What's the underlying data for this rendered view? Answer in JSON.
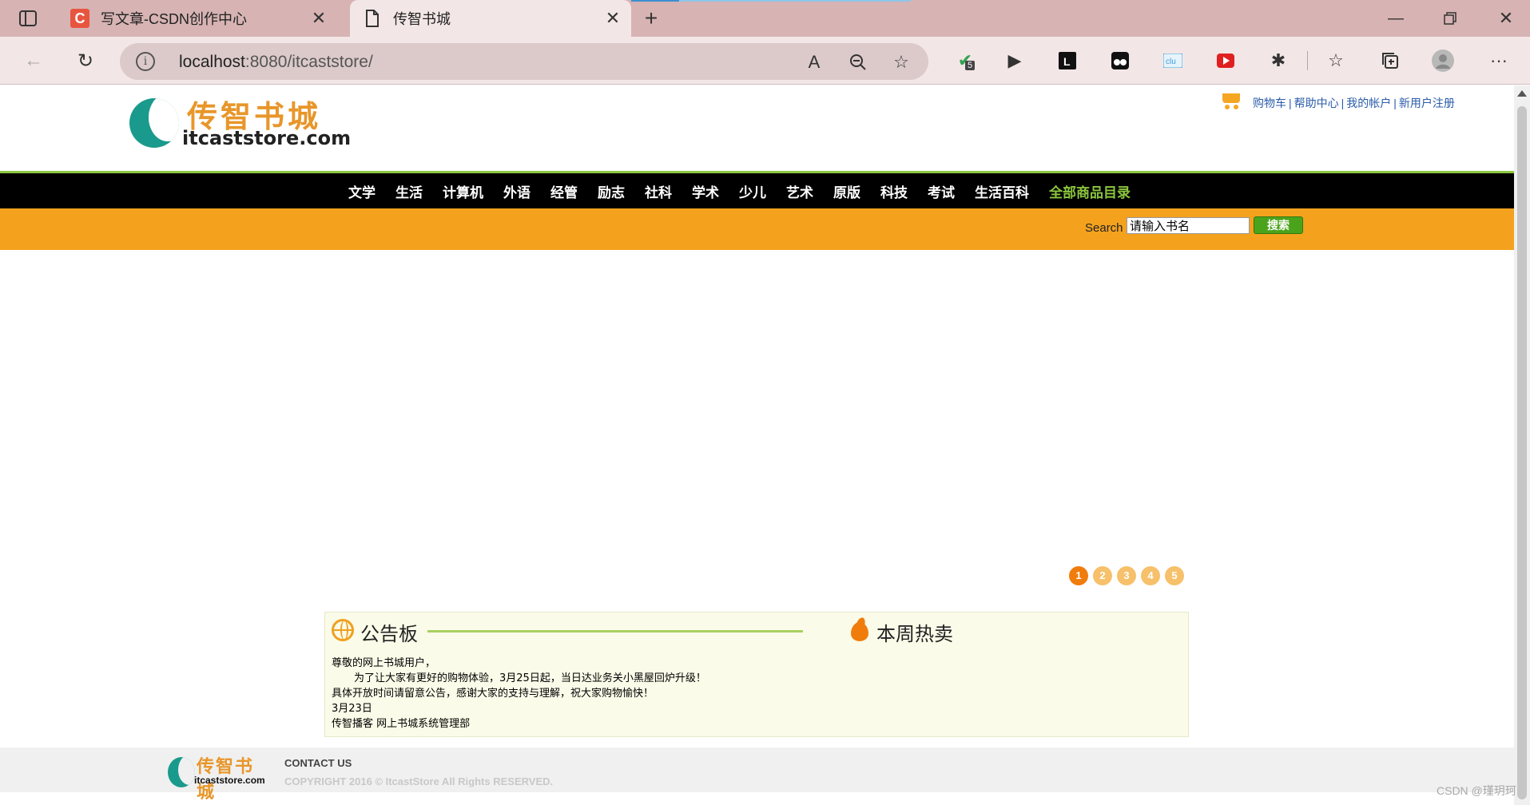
{
  "browser": {
    "tabs": [
      {
        "title": "写文章-CSDN创作中心",
        "favicon": "csdn-icon"
      },
      {
        "title": "传智书城",
        "favicon": "page-icon"
      }
    ],
    "address": {
      "host": "localhost",
      "rest": ":8080/itcaststore/"
    },
    "ext_badge": "5"
  },
  "header": {
    "logo_cn": "传智书城",
    "logo_en": "itcaststore.com",
    "links": [
      "购物车",
      "帮助中心",
      "我的帐户",
      "新用户注册"
    ]
  },
  "nav": {
    "items": [
      "文学",
      "生活",
      "计算机",
      "外语",
      "经管",
      "励志",
      "社科",
      "学术",
      "少儿",
      "艺术",
      "原版",
      "科技",
      "考试",
      "生活百科"
    ],
    "all_label": "全部商品目录"
  },
  "search": {
    "label": "Search",
    "value": "请输入书名",
    "button": "搜索"
  },
  "carousel": {
    "pages": [
      "1",
      "2",
      "3",
      "4",
      "5"
    ],
    "active_page": "1"
  },
  "notice_board": {
    "title": "公告板",
    "lines": [
      "尊敬的网上书城用户，",
      "为了让大家有更好的购物体验，3月25日起，当日达业务关小黑屋回炉升级！",
      "具体开放时间请留意公告，感谢大家的支持与理解，祝大家购物愉快！",
      "3月23日",
      "传智播客 网上书城系统管理部"
    ]
  },
  "hot": {
    "title": "本周热卖"
  },
  "footer": {
    "logo_cn": "传智书城",
    "logo_en": "itcaststore.com",
    "contact": "CONTACT US",
    "copyright": "COPYRIGHT 2016 © ItcastStore All Rights RESERVED."
  },
  "watermark": "CSDN @瑾玥珂",
  "colors": {
    "nav_bg": "#000000",
    "accent_green": "#8cc63f",
    "search_bar": "#f4a21e",
    "logo_orange": "#e8962a",
    "logo_teal": "#1a9a8c"
  }
}
